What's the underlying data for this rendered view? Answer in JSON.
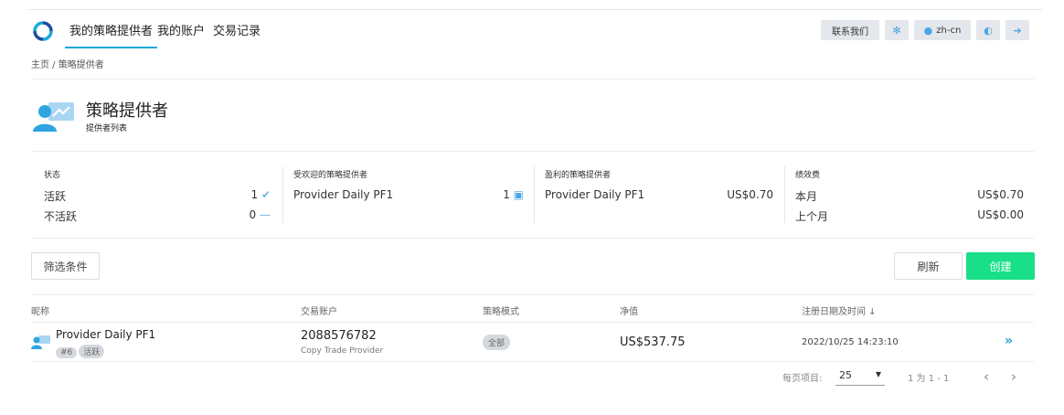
{
  "nav": {
    "tabs": [
      "我的策略提供者",
      "我的账户",
      "交易记录"
    ],
    "contact": "联系我们",
    "lang": "zh-cn"
  },
  "breadcrumb": "主页 / 策略提供者",
  "header": {
    "title": "策略提供者",
    "subtitle": "提供者列表"
  },
  "stats": {
    "status": {
      "label": "状态",
      "active_label": "活跃",
      "active_count": "1",
      "inactive_label": "不活跃",
      "inactive_count": "0"
    },
    "popular": {
      "label": "受欢迎的策略提供者",
      "name": "Provider Daily PF1",
      "count": "1"
    },
    "profitable": {
      "label": "盈利的策略提供者",
      "name": "Provider Daily PF1",
      "amount": "US$0.70"
    },
    "fees": {
      "label": "绩效费",
      "this_month_label": "本月",
      "this_month": "US$0.70",
      "last_month_label": "上个月",
      "last_month": "US$0.00"
    }
  },
  "toolbar": {
    "filter": "筛选条件",
    "refresh": "刷新",
    "create": "创建"
  },
  "table": {
    "columns": [
      "昵称",
      "交易账户",
      "策略模式",
      "净值",
      "注册日期及时间 ↓"
    ],
    "rows": [
      {
        "name": "Provider Daily PF1",
        "id_tag": "#6",
        "status_tag": "活跃",
        "account": "2088576782",
        "account_type": "Copy Trade Provider",
        "mode": "全部",
        "equity": "US$537.75",
        "registered": "2022/10/25 14:23:10"
      }
    ]
  },
  "pagination": {
    "per_page_label": "每页项目:",
    "per_page": "25",
    "range": "1 为 1 - 1"
  },
  "colors": {
    "accent": "#1ba9d8",
    "create": "#19df88",
    "icon": "#49a6e6"
  }
}
